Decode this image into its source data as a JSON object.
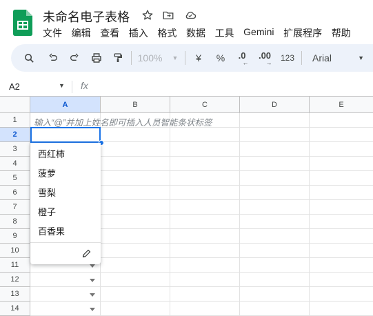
{
  "doc": {
    "title": "未命名电子表格"
  },
  "menu": [
    "文件",
    "编辑",
    "查看",
    "插入",
    "格式",
    "数据",
    "工具",
    "Gemini",
    "扩展程序",
    "帮助"
  ],
  "toolbar": {
    "zoom": "100%",
    "currency": "¥",
    "percent": "%",
    "decrease_decimal": ".0",
    "increase_decimal": ".00",
    "number_format": "123",
    "font": "Arial"
  },
  "formula_bar": {
    "name_box": "A2",
    "fx": "fx"
  },
  "columns": [
    "A",
    "B",
    "C",
    "D",
    "E"
  ],
  "rows": [
    "1",
    "2",
    "3",
    "4",
    "5",
    "6",
    "7",
    "8",
    "9",
    "10",
    "11",
    "12",
    "13",
    "14"
  ],
  "cells": {
    "A1_placeholder": "输入“@”并加上姓名即可插入人员智能条状标签"
  },
  "dropdown": {
    "options": [
      "西红柿",
      "菠萝",
      "雪梨",
      "橙子",
      "百香果"
    ]
  },
  "colors": {
    "accent": "#1a73e8",
    "selected_header": "#d3e3fd",
    "toolbar_bg": "#edf2fa",
    "sheets_green": "#0f9d58"
  }
}
